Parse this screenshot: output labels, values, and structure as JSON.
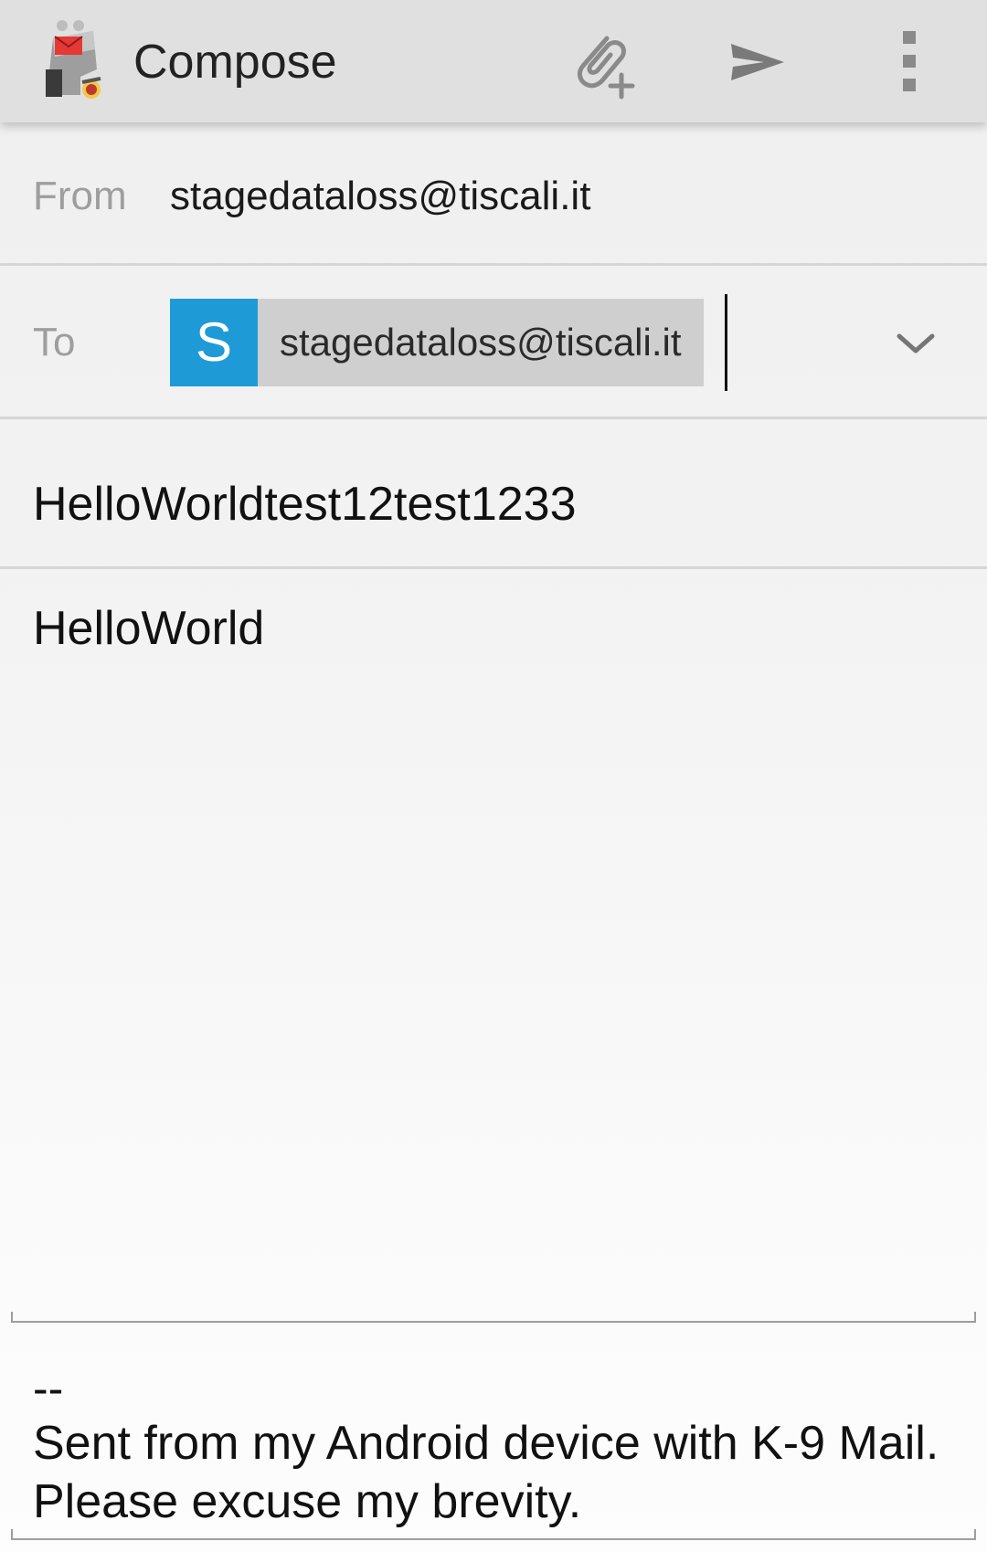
{
  "appbar": {
    "title": "Compose",
    "app_icon": "k9-mail-robot-dog-icon",
    "actions": [
      {
        "name": "attach-add-icon"
      },
      {
        "name": "send-icon"
      },
      {
        "name": "overflow-menu-icon"
      }
    ]
  },
  "from": {
    "label": "From",
    "value": "stagedataloss@tiscali.it"
  },
  "to": {
    "label": "To",
    "recipients": [
      {
        "initial": "S",
        "address": "stagedataloss@tiscali.it",
        "avatar_color": "#1e9bd6"
      }
    ],
    "expand_icon": "chevron-down-icon"
  },
  "subject": {
    "value": "HelloWorldtest12test1233"
  },
  "body": {
    "value": "HelloWorld"
  },
  "signature": {
    "separator": "--",
    "text": "Sent from my Android device with K-9 Mail. Please excuse my brevity."
  },
  "colors": {
    "appbar_bg": "#e0e0e0",
    "accent": "#1e9bd6",
    "chip_bg": "#cfcfcf"
  }
}
